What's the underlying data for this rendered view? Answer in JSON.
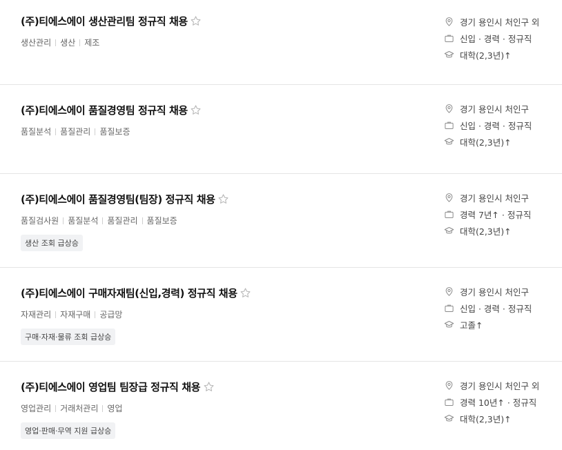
{
  "jobs": [
    {
      "title": "(주)티에스에이 생산관리팀 정규직 채용",
      "tags": [
        "생산관리",
        "생산",
        "제조"
      ],
      "badge": "",
      "location": "경기 용인시 처인구 외",
      "career": "신입 · 경력 · 정규직",
      "education": "대학(2,3년)↑"
    },
    {
      "title": "(주)티에스에이 품질경영팀 정규직 채용",
      "tags": [
        "품질분석",
        "품질관리",
        "품질보증"
      ],
      "badge": "",
      "location": "경기 용인시 처인구",
      "career": "신입 · 경력 · 정규직",
      "education": "대학(2,3년)↑"
    },
    {
      "title": "(주)티에스에이 품질경영팀(팀장) 정규직 채용",
      "tags": [
        "품질검사원",
        "품질분석",
        "품질관리",
        "품질보증"
      ],
      "badge": "생산 조회 급상승",
      "location": "경기 용인시 처인구",
      "career": "경력 7년↑ · 정규직",
      "education": "대학(2,3년)↑"
    },
    {
      "title": "(주)티에스에이 구매자재팀(신입,경력) 정규직 채용",
      "tags": [
        "자재관리",
        "자재구매",
        "공급망"
      ],
      "badge": "구매·자재·물류 조회 급상승",
      "location": "경기 용인시 처인구",
      "career": "신입 · 경력 · 정규직",
      "education": "고졸↑"
    },
    {
      "title": "(주)티에스에이 영업팀 팀장급 정규직 채용",
      "tags": [
        "영업관리",
        "거래처관리",
        "영업"
      ],
      "badge": "영업·판매·무역 지원 급상승",
      "location": "경기 용인시 처인구 외",
      "career": "경력 10년↑ · 정규직",
      "education": "대학(2,3년)↑"
    }
  ],
  "icons": {
    "favorite": "star-outline-icon",
    "location": "location-pin-icon",
    "career": "briefcase-icon",
    "education": "graduation-cap-icon"
  },
  "colors": {
    "title": "#111111",
    "meta_text": "#444444",
    "tag_text": "#666666",
    "badge_bg": "#f1f2f4",
    "star_stroke": "#b5b5b5",
    "icon_stroke": "#8a8a8a"
  }
}
